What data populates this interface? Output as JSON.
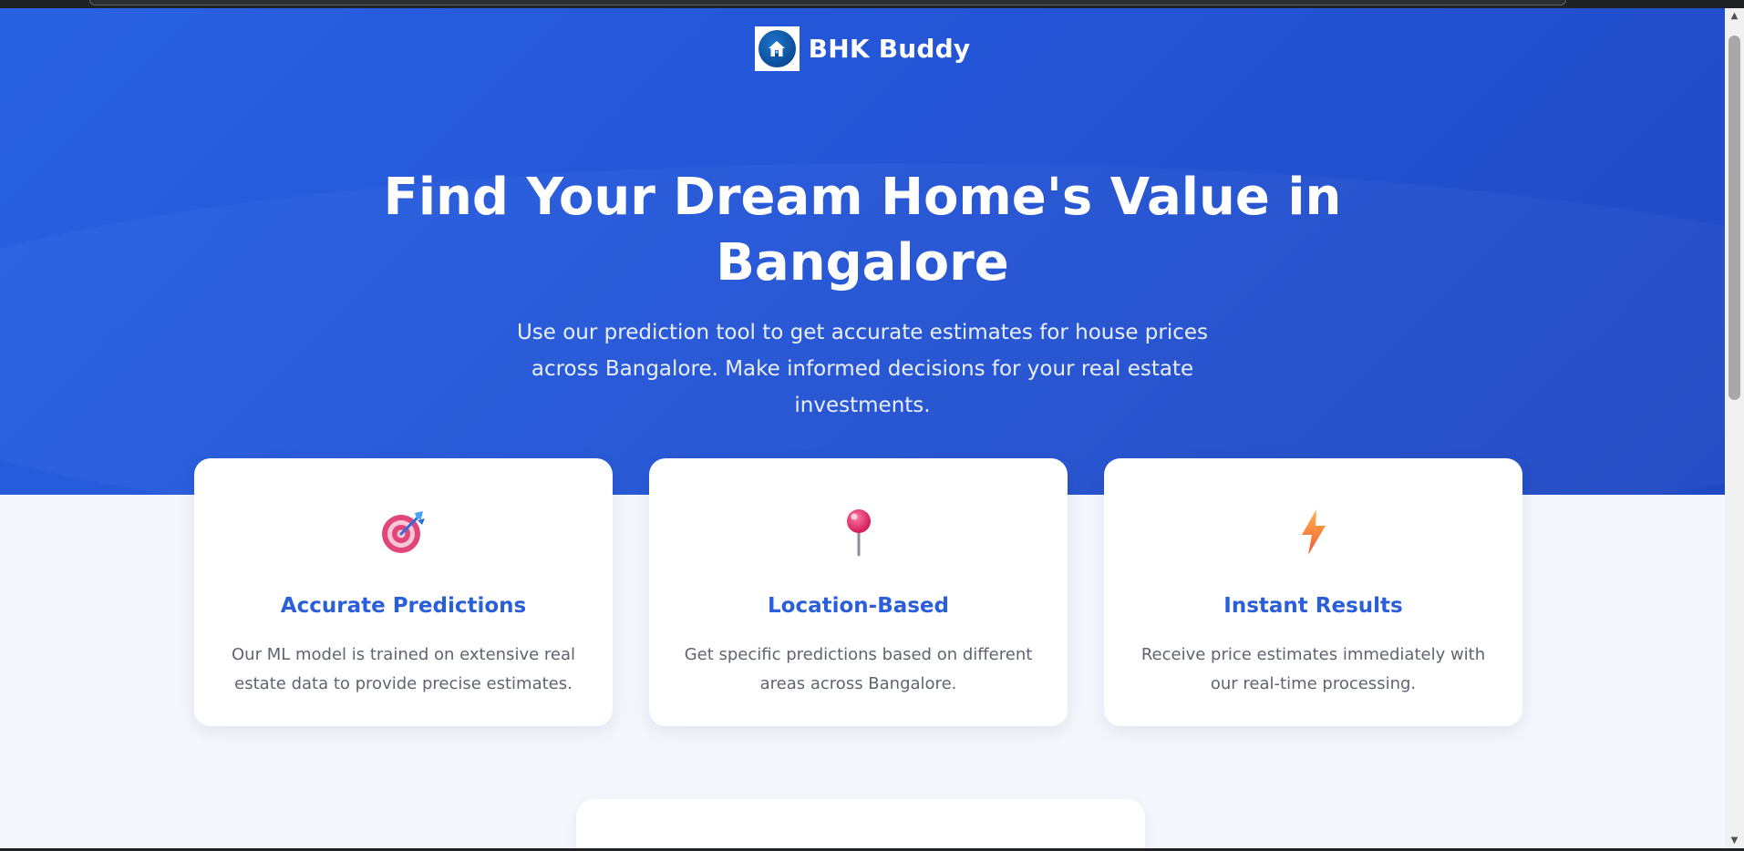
{
  "brand": {
    "name": "BHK Buddy",
    "logo_icon": "house-icon"
  },
  "hero": {
    "title": "Find Your Dream Home's Value in Bangalore",
    "subtitle": "Use our prediction tool to get accurate estimates for house prices across Bangalore. Make informed decisions for your real estate investments.",
    "gradient_start": "#2862e2",
    "gradient_end": "#2149c4"
  },
  "features": [
    {
      "icon": "target-icon",
      "title": "Accurate Predictions",
      "description": "Our ML model is trained on extensive real estate data to provide precise estimates."
    },
    {
      "icon": "pushpin-icon",
      "title": "Location-Based",
      "description": "Get specific predictions based on different areas across Bangalore."
    },
    {
      "icon": "lightning-icon",
      "title": "Instant Results",
      "description": "Receive price estimates immediately with our real-time processing."
    }
  ],
  "colors": {
    "accent": "#2a5fd9",
    "page_background": "#f3f6fb",
    "card_text": "#5e6470"
  }
}
